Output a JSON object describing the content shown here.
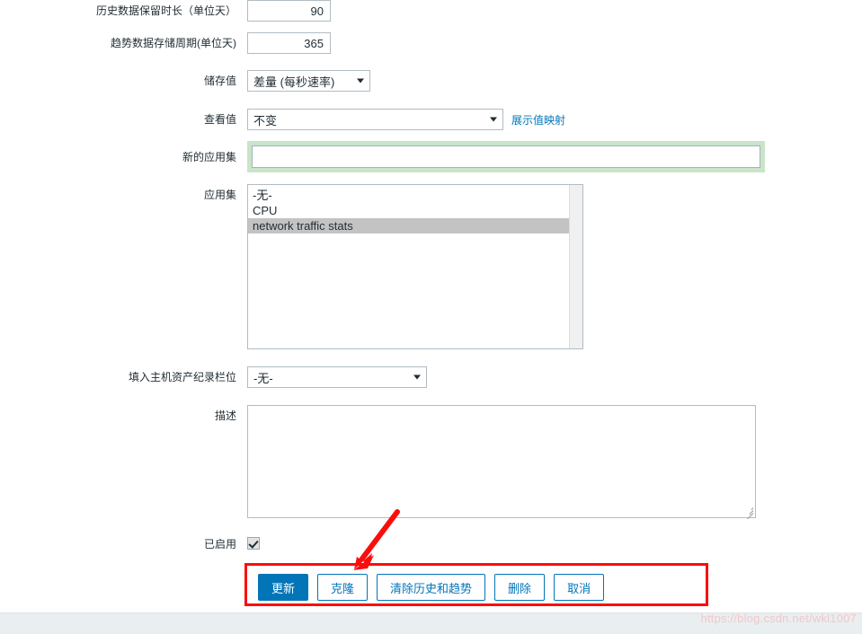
{
  "form": {
    "fields": {
      "history": {
        "label": "历史数据保留时长（单位天）",
        "value": "90"
      },
      "trends": {
        "label": "趋势数据存储周期(单位天)",
        "value": "365"
      },
      "store_value": {
        "label": "储存值",
        "value": "差量 (每秒速率)"
      },
      "show_value": {
        "label": "查看值",
        "value": "不变",
        "link_label": "展示值映射"
      },
      "new_application": {
        "label": "新的应用集",
        "value": "",
        "placeholder": ""
      },
      "applications": {
        "label": "应用集",
        "options": [
          {
            "label": "-无-",
            "selected": false
          },
          {
            "label": "CPU",
            "selected": false
          },
          {
            "label": "network traffic stats",
            "selected": true
          }
        ]
      },
      "inventory_field": {
        "label": "填入主机资产纪录栏位",
        "value": "-无-"
      },
      "description": {
        "label": "描述",
        "value": "",
        "placeholder": ""
      },
      "enabled": {
        "label": "已启用",
        "checked": true
      }
    }
  },
  "buttons": [
    {
      "name": "update",
      "label": "更新",
      "style": "primary"
    },
    {
      "name": "clone",
      "label": "克隆",
      "style": "secondary"
    },
    {
      "name": "clear-history",
      "label": "清除历史和趋势",
      "style": "secondary"
    },
    {
      "name": "delete",
      "label": "删除",
      "style": "secondary"
    },
    {
      "name": "cancel",
      "label": "取消",
      "style": "secondary"
    }
  ],
  "annotations": {
    "highlight_color": "#fb0d0d",
    "arrow_color": "#fb0d0d"
  },
  "watermark": {
    "text": "https://blog.csdn.net/wkl1007"
  },
  "colors": {
    "accent": "#0275b8",
    "field_border": "#b0bcc4",
    "valid_highlight": "#c9e4c9",
    "selected_option": "#c3c3c3",
    "footer": "#e9eef1"
  }
}
